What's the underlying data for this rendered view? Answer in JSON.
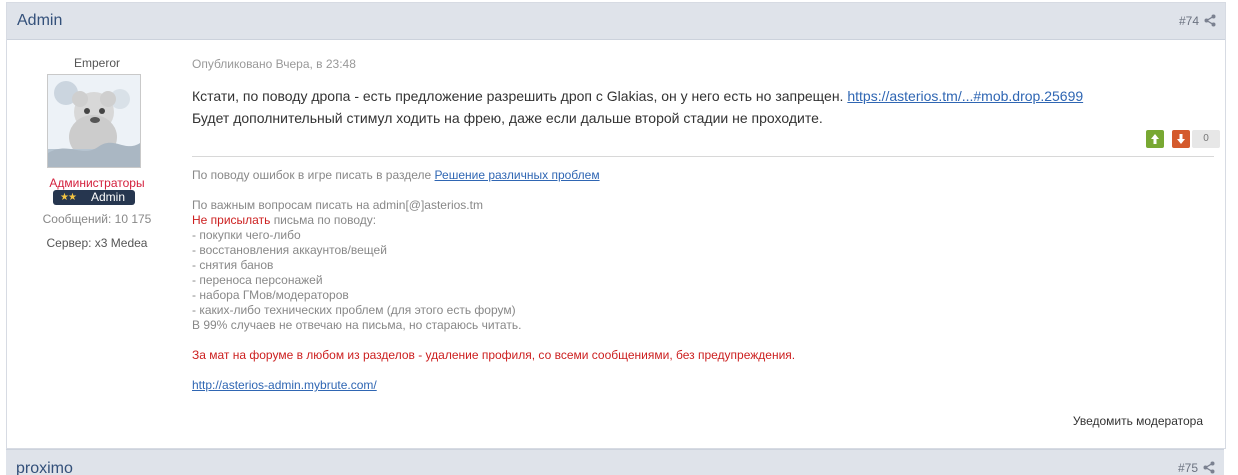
{
  "post": {
    "author": "Admin",
    "number": "#74",
    "icons": {
      "share": "share-icon"
    },
    "author_info": {
      "title": "Emperor",
      "group": "Администраторы",
      "badge": {
        "stars": "★★",
        "label": "Admin"
      },
      "messages": "Сообщений: 10 175",
      "server": "Сервер: x3 Medea"
    },
    "meta": "Опубликовано Вчера, в 23:48",
    "content": {
      "line1_text": "Кстати, по поводу дропа - есть предложение разрешить дроп с Glakias, он у него есть но запрещен.",
      "link_text": "https://asterios.tm/...#mob.drop.25699",
      "line2_text": "Будет дополнительный стимул ходить на фрею, даже если дальше второй стадии не проходите."
    },
    "votes": {
      "count": "0"
    },
    "signature": {
      "line1_prefix": "По поводу ошибок в игре писать в разделе",
      "line1_link": "Решение различных проблем",
      "line2": "По важным вопросам писать на admin[@]asterios.tm",
      "line3_red": "Не присылать",
      "line3_rest": "письма по поводу:",
      "items": [
        "- покупки чего-либо",
        "- восстановления аккаунтов/вещей",
        "- снятия банов",
        "- переноса персонажей",
        "- набора ГМов/модераторов",
        "- каких-либо технических проблем (для этого есть форум)"
      ],
      "email_note": "В 99% случаев не отвечаю на письма, но стараюсь читать.",
      "warning": "За мат на форуме в любом из разделов - удаление профиля, со всеми сообщениями, без предупреждения.",
      "site_link": "http://asterios-admin.mybrute.com/"
    },
    "report_link": "Уведомить модератора"
  },
  "next_post": {
    "author": "proximo",
    "number": "#75"
  },
  "colors": {
    "header_bg": "#dfe3ea",
    "link": "#2f66b3",
    "group_red": "#d4213d",
    "warning_red": "#cc1f1f",
    "vote_up": "#78a832",
    "vote_down": "#d45a2c"
  }
}
